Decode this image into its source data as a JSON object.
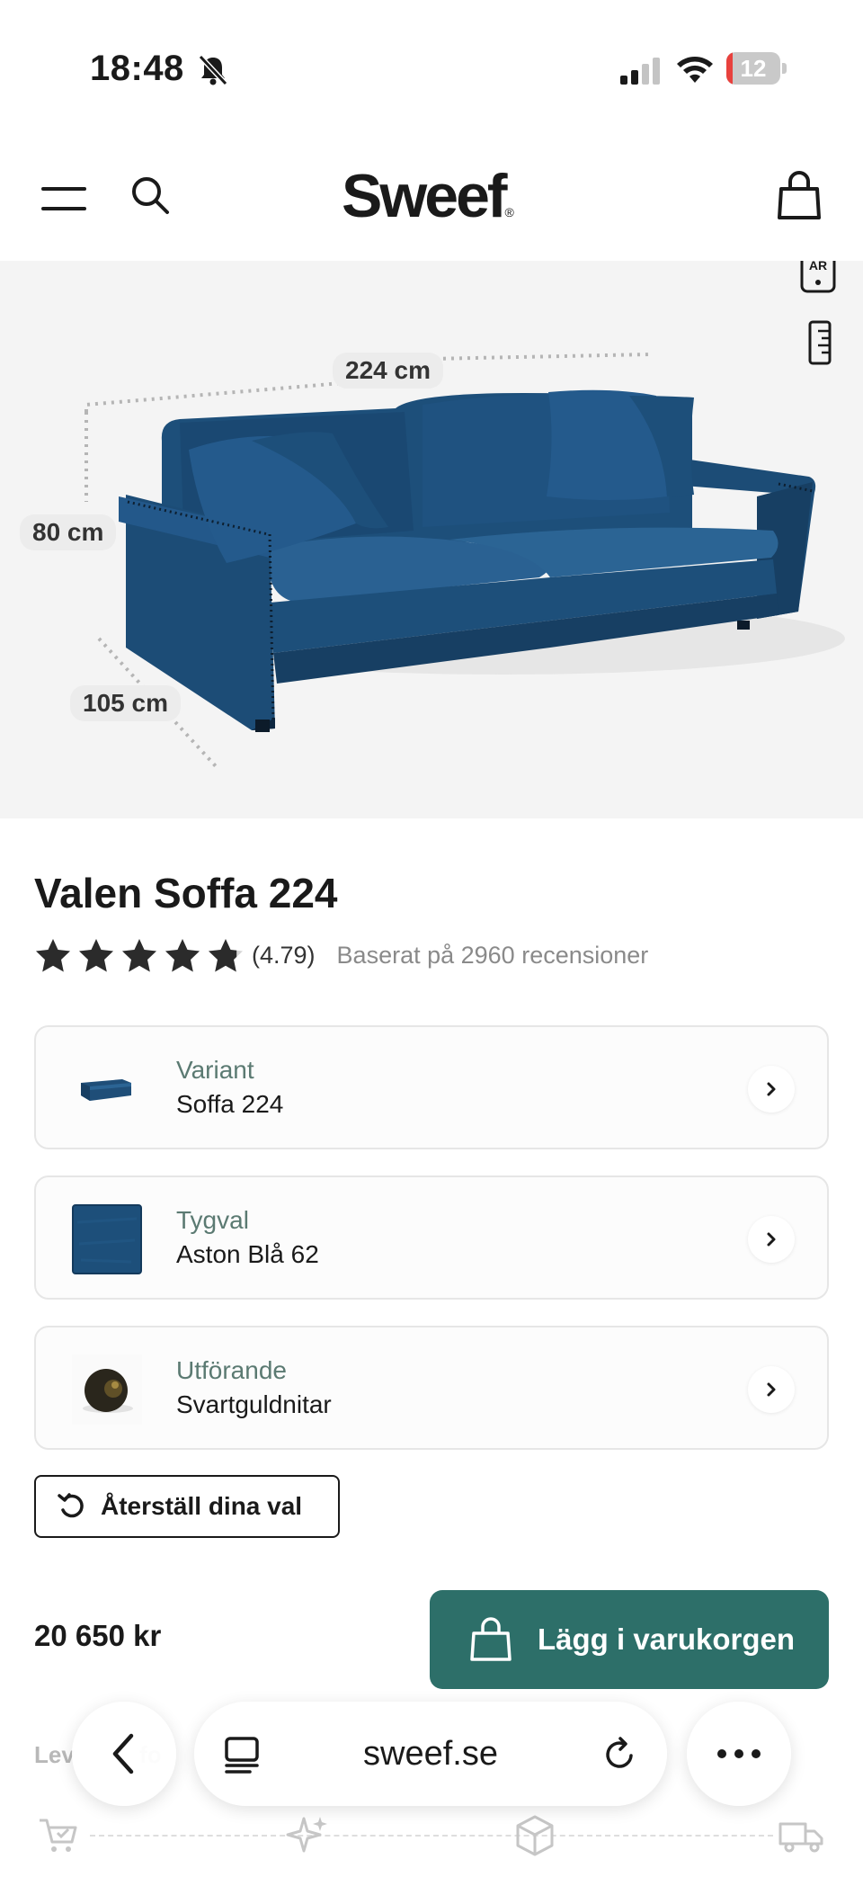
{
  "status_bar": {
    "time": "18:48",
    "battery_level": "12",
    "battery_fraction": 0.12,
    "icons": [
      "bell-off-icon",
      "signal-icon",
      "wifi-icon",
      "battery-icon"
    ]
  },
  "header": {
    "brand": "Sweef",
    "brand_mark": "®",
    "icons": [
      "menu-icon",
      "search-icon",
      "shopping-bag-icon"
    ]
  },
  "hero": {
    "dimensions": {
      "width": "224 cm",
      "height": "80 cm",
      "depth": "105 cm"
    },
    "ar_label": "AR",
    "icons": [
      "ar-view-icon",
      "ruler-icon"
    ]
  },
  "product": {
    "title": "Valen Soffa 224",
    "rating_stars": 4.79,
    "rating_value": "(4.79)",
    "rating_text": "Baserat på 2960 recensioner"
  },
  "options": [
    {
      "label": "Variant",
      "value": "Soffa 224",
      "thumb": "sofa-thumbnail"
    },
    {
      "label": "Tygval",
      "value": "Aston Blå 62",
      "thumb": "fabric-swatch"
    },
    {
      "label": "Utförande",
      "value": "Svartguldnitar",
      "thumb": "rivet-thumbnail"
    }
  ],
  "reset_label": "Återställ dina val",
  "price": "20 650 kr",
  "cart_button_label": "Lägg i varukorgen",
  "delivery_text_partial": "Lev          fo",
  "browser": {
    "url": "sweef.se",
    "icons": [
      "back-icon",
      "tabs-icon",
      "reload-icon",
      "more-icon"
    ]
  },
  "colors": {
    "accent": "#2d6f69",
    "option_label": "#5b7a72",
    "sofa_blue": "#1f4e78",
    "hero_bg": "#f4f4f4"
  }
}
